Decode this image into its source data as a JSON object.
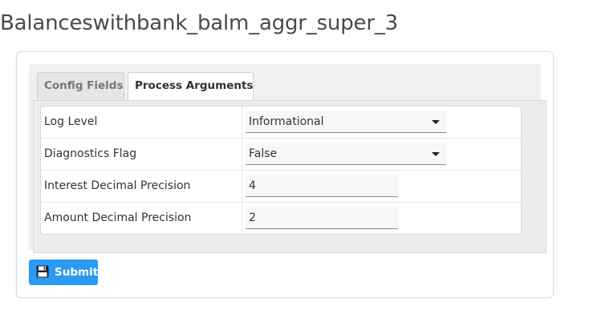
{
  "page": {
    "title": "Balanceswithbank_balm_aggr_super_3"
  },
  "tabs": [
    {
      "label": "Config Fields",
      "active": false
    },
    {
      "label": "Process Arguments",
      "active": true
    }
  ],
  "process_arguments": {
    "rows": [
      {
        "label": "Log Level",
        "type": "select",
        "value": "Informational"
      },
      {
        "label": "Diagnostics Flag",
        "type": "select",
        "value": "False"
      },
      {
        "label": "Interest Decimal Precision",
        "type": "text",
        "value": "4"
      },
      {
        "label": "Amount Decimal Precision",
        "type": "text",
        "value": "2"
      }
    ]
  },
  "actions": {
    "submit_label": "Submit",
    "submit_icon": "save-icon"
  },
  "colors": {
    "submit_button": "#2b9af3",
    "panel_background": "#f0f0f0"
  }
}
